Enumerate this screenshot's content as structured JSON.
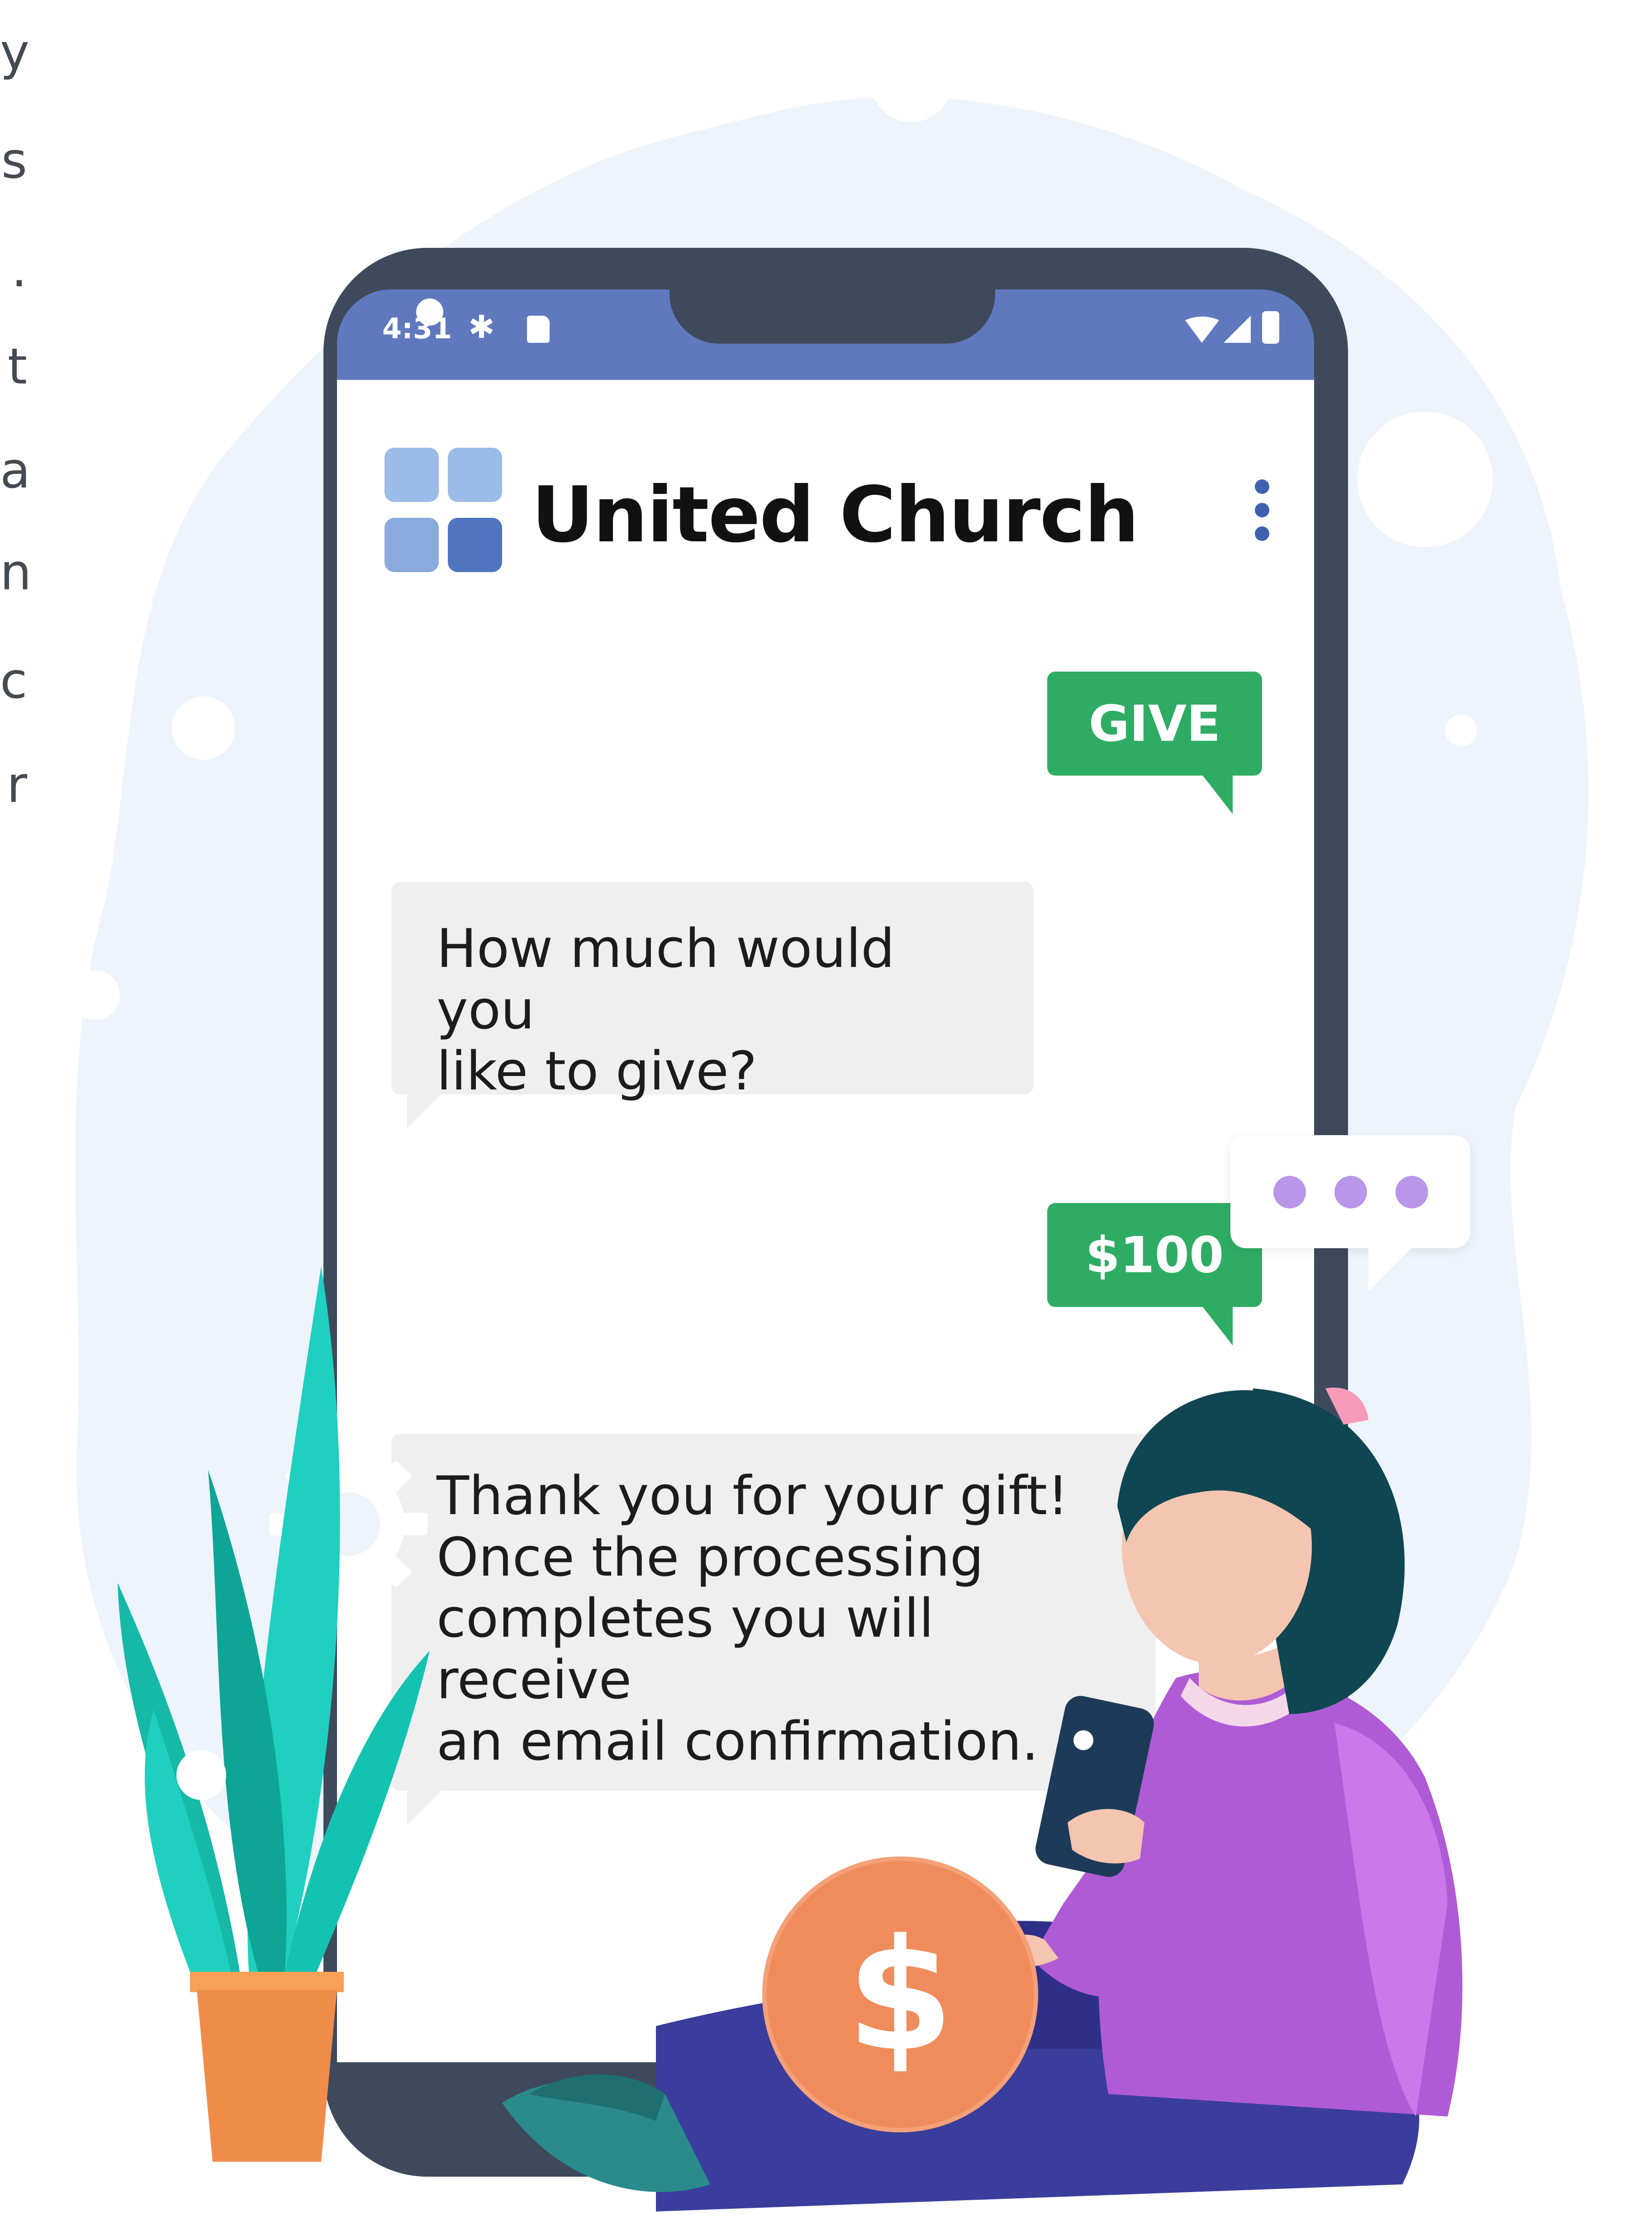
{
  "side_text": {
    "letters": [
      "y",
      "s",
      ".",
      "t",
      "a",
      "n",
      "c",
      "r"
    ]
  },
  "status_bar": {
    "time": "4:31",
    "left_icons": [
      "settings-icon",
      "sd-card-icon"
    ],
    "right_icons": [
      "wifi-icon",
      "signal-icon",
      "battery-icon"
    ]
  },
  "app": {
    "title": "United Church",
    "menu_icon": "more-vert-icon"
  },
  "chat": {
    "messages": [
      {
        "sender": "user",
        "text": "GIVE"
      },
      {
        "sender": "bot",
        "text": "How much would you\nlike to give?"
      },
      {
        "sender": "user",
        "text": "$100"
      },
      {
        "sender": "bot",
        "text": "Thank you for your gift!\nOnce the processing\ncompletes you will receive\nan email confirmation."
      }
    ],
    "typing_indicator": "typing-dots"
  },
  "illustration": {
    "coin_symbol": "$"
  },
  "colors": {
    "status_bar": "#6079be",
    "phone_frame": "#3e4a5c",
    "user_bubble": "#2fac64",
    "bot_bubble": "#efefef",
    "logo_blue": "#8fb0e3",
    "logo_dark": "#4f74c0",
    "coin": "#f08c5c",
    "shirt": "#b05bd6",
    "pants": "#3b3d9c",
    "plant": "#19c4b4",
    "pot": "#f08c4a",
    "blob": "#eef4fb",
    "typing_dots": "#b996ea"
  }
}
